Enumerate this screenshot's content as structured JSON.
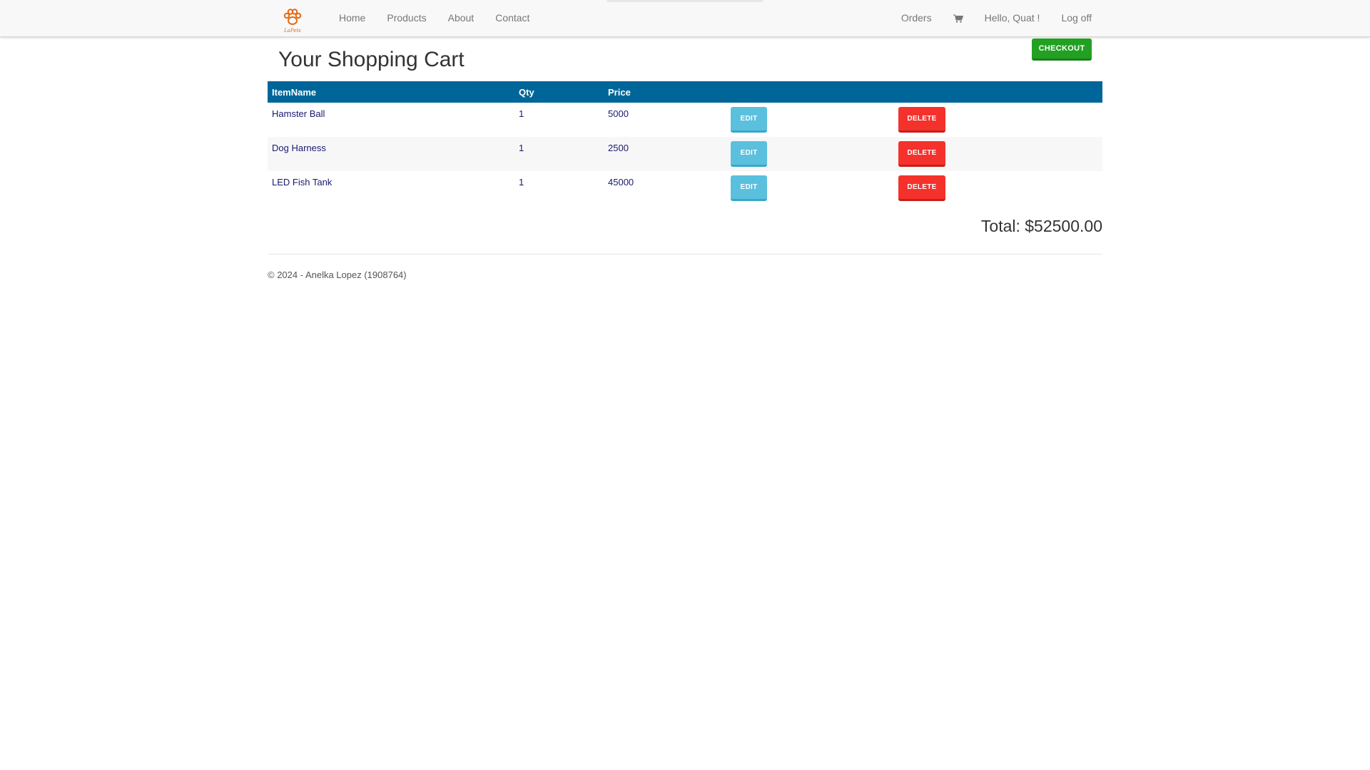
{
  "brand": {
    "text": "LaPets",
    "accent": "#e46a17"
  },
  "nav": {
    "left": [
      "Home",
      "Products",
      "About",
      "Contact"
    ],
    "right": {
      "orders": "Orders",
      "cart_icon": "shopping-cart-icon",
      "greeting": "Hello, Quat !",
      "logoff": "Log off"
    }
  },
  "page": {
    "title": "Your Shopping Cart",
    "checkout_label": "CHECKOUT"
  },
  "table": {
    "headers": [
      "ItemName",
      "Qty",
      "Price"
    ],
    "rows": [
      {
        "name": "Hamster Ball",
        "qty": "1",
        "price": "5000"
      },
      {
        "name": "Dog Harness",
        "qty": "1",
        "price": "2500"
      },
      {
        "name": "LED Fish Tank",
        "qty": "1",
        "price": "45000"
      }
    ],
    "edit_label": "EDIT",
    "delete_label": "DELETE"
  },
  "total": "Total: $52500.00",
  "footer": "© 2024 - Anelka Lopez (1908764)",
  "colors": {
    "header_bg": "#006699",
    "checkout": "#22a022",
    "edit": "#5bc0de",
    "delete": "#f5312b",
    "cell_text": "#191970"
  }
}
